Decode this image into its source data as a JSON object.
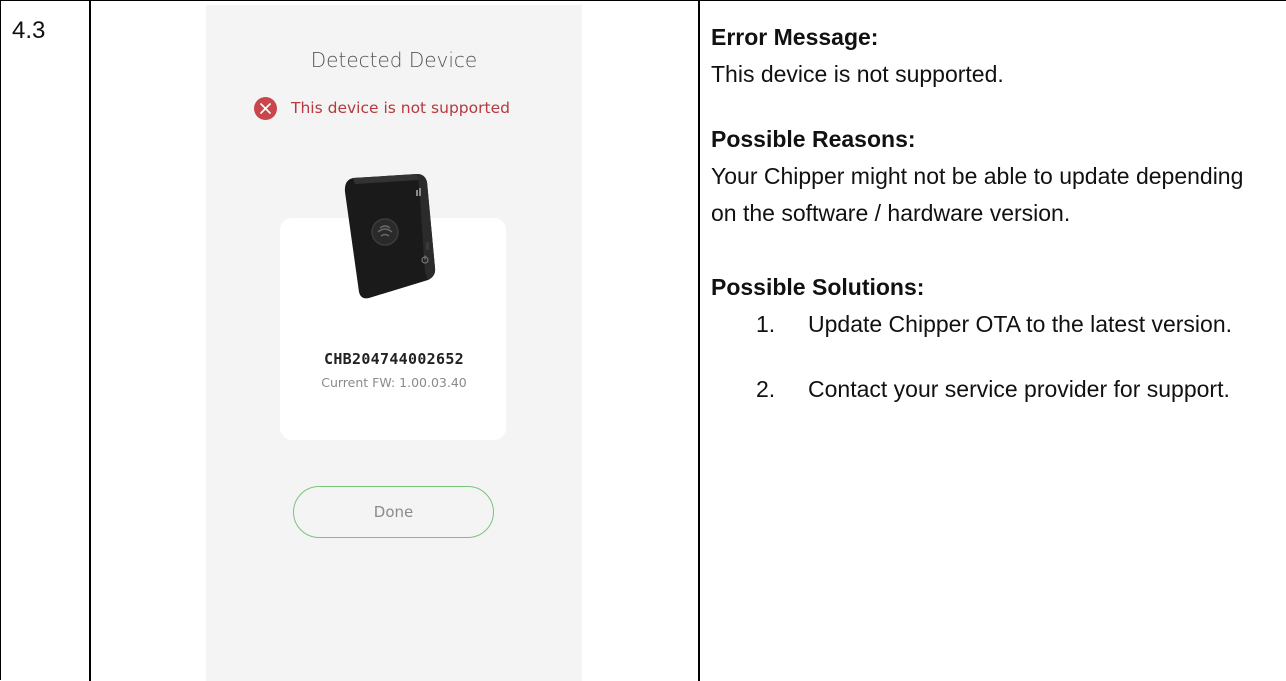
{
  "row": {
    "number": "4.3"
  },
  "phone": {
    "title": "Detected Device",
    "status": {
      "icon": "error-x-circle-icon",
      "text": "This device is not supported",
      "color": "#c9474c"
    },
    "device": {
      "icon": "card-reader-device-icon",
      "serial": "CHB204744002652",
      "firmware": "Current FW: 1.00.03.40"
    },
    "done_label": "Done",
    "accent_color": "#7cc37a"
  },
  "details": {
    "error_heading": "Error Message:",
    "error_text": "This device is not supported.",
    "reasons_heading": "Possible Reasons:",
    "reasons_text": "Your Chipper might not be able to update depending on the software / hardware version.",
    "solutions_heading": "Possible Solutions:",
    "solutions": [
      {
        "number": "1.",
        "text": "Update Chipper OTA to the latest version."
      },
      {
        "number": "2.",
        "text": "Contact your service provider for support."
      }
    ]
  }
}
